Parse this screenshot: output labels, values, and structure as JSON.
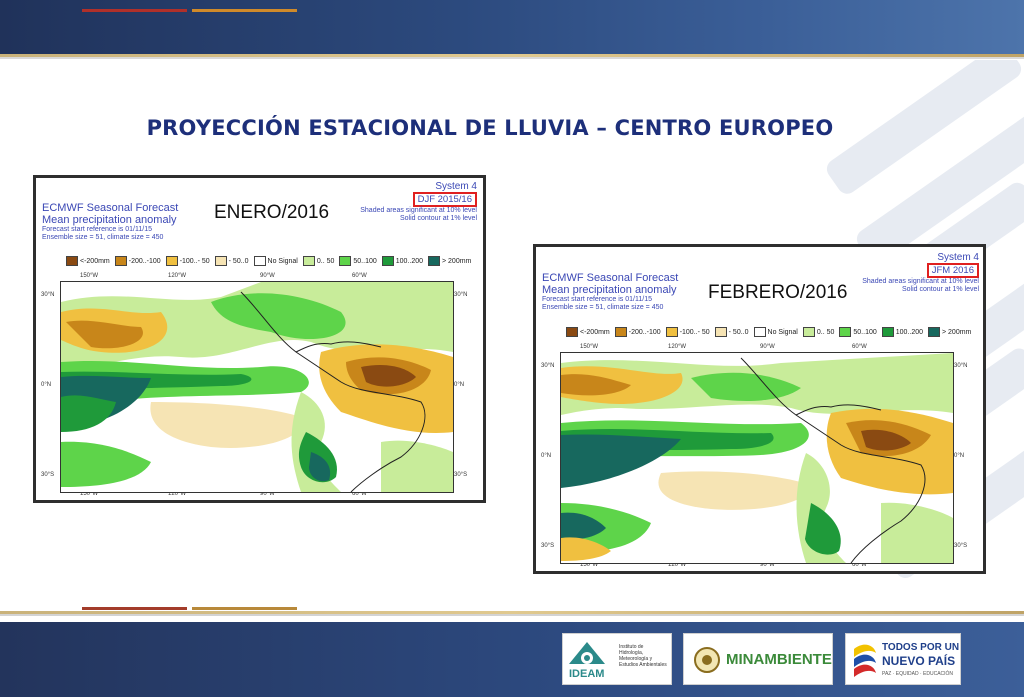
{
  "slide": {
    "title": "PROYECCIÓN ESTACIONAL DE LLUVIA – CENTRO EUROPEO"
  },
  "panels": [
    {
      "label": "ENERO/2016",
      "header": {
        "line1": "ECMWF Seasonal Forecast",
        "line2": "Mean precipitation anomaly",
        "line3": "Forecast start reference is 01/11/15",
        "line4": "Ensemble size = 51, climate size = 450"
      },
      "right": {
        "system": "System 4",
        "period": "DJF 2015/16",
        "note1": "Shaded areas significant at 10% level",
        "note2": "Solid contour at 1% level"
      }
    },
    {
      "label": "FEBRERO/2016",
      "header": {
        "line1": "ECMWF Seasonal Forecast",
        "line2": "Mean precipitation anomaly",
        "line3": "Forecast start reference is 01/11/15",
        "line4": "Ensemble size = 51, climate size = 450"
      },
      "right": {
        "system": "System 4",
        "period": "JFM 2016",
        "note1": "Shaded areas significant at 10% level",
        "note2": "Solid contour at 1% level"
      }
    }
  ],
  "legend": [
    {
      "label": "<-200mm",
      "color": "#8a4a12"
    },
    {
      "label": "-200..-100",
      "color": "#c8861a"
    },
    {
      "label": "-100..- 50",
      "color": "#f0c040"
    },
    {
      "label": "- 50..0",
      "color": "#f6e4b4"
    },
    {
      "label": "No Signal",
      "color": "#ffffff"
    },
    {
      "label": "0.. 50",
      "color": "#c8ec9a"
    },
    {
      "label": "50..100",
      "color": "#5ed44a"
    },
    {
      "label": "100..200",
      "color": "#1f9a3a"
    },
    {
      "label": "> 200mm",
      "color": "#17685e"
    }
  ],
  "axes": {
    "lon": [
      "150°W",
      "120°W",
      "90°W",
      "60°W"
    ],
    "lat": [
      "30°N",
      "0°N",
      "30°S"
    ]
  },
  "footer": {
    "ideam_name": "IDEAM",
    "ideam_sub": "Instituto de Hidrología, Meteorología y Estudios Ambientales",
    "minamb": "MINAMBIENTE",
    "tpn_line1": "TODOS POR UN",
    "tpn_line2": "NUEVO PAÍS",
    "tpn_line3": "PAZ · EQUIDAD · EDUCACIÓN"
  }
}
